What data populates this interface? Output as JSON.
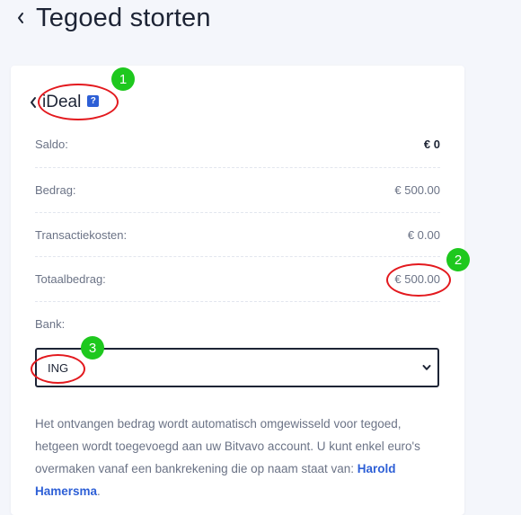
{
  "header": {
    "title": "Tegoed storten",
    "back_icon": "chevron-left-icon"
  },
  "method": {
    "name": "iDeal",
    "help_glyph": "?"
  },
  "summary": [
    {
      "label": "Saldo:",
      "value": "€ 0"
    },
    {
      "label": "Bedrag:",
      "value": "€ 500.00"
    },
    {
      "label": "Transactiekosten:",
      "value": "€ 0.00"
    },
    {
      "label": "Totaalbedrag:",
      "value": "€ 500.00"
    }
  ],
  "bank": {
    "label": "Bank:",
    "selected": "ING"
  },
  "info": {
    "text": "Het ontvangen bedrag wordt automatisch omgewisseld voor tegoed, hetgeen wordt toegevoegd aan uw Bitvavo account. U kunt enkel euro's overmaken vanaf een bankrekening die op naam staat van: ",
    "name": "Harold Hamersma",
    "end": "."
  },
  "annotations": {
    "badge_1": "1",
    "badge_2": "2",
    "badge_3": "3"
  },
  "colors": {
    "accent": "#2d5fd6",
    "annotation_red": "#e3191e",
    "annotation_green": "#1ec81e",
    "text": "#1d2435",
    "muted": "#6b7386"
  }
}
